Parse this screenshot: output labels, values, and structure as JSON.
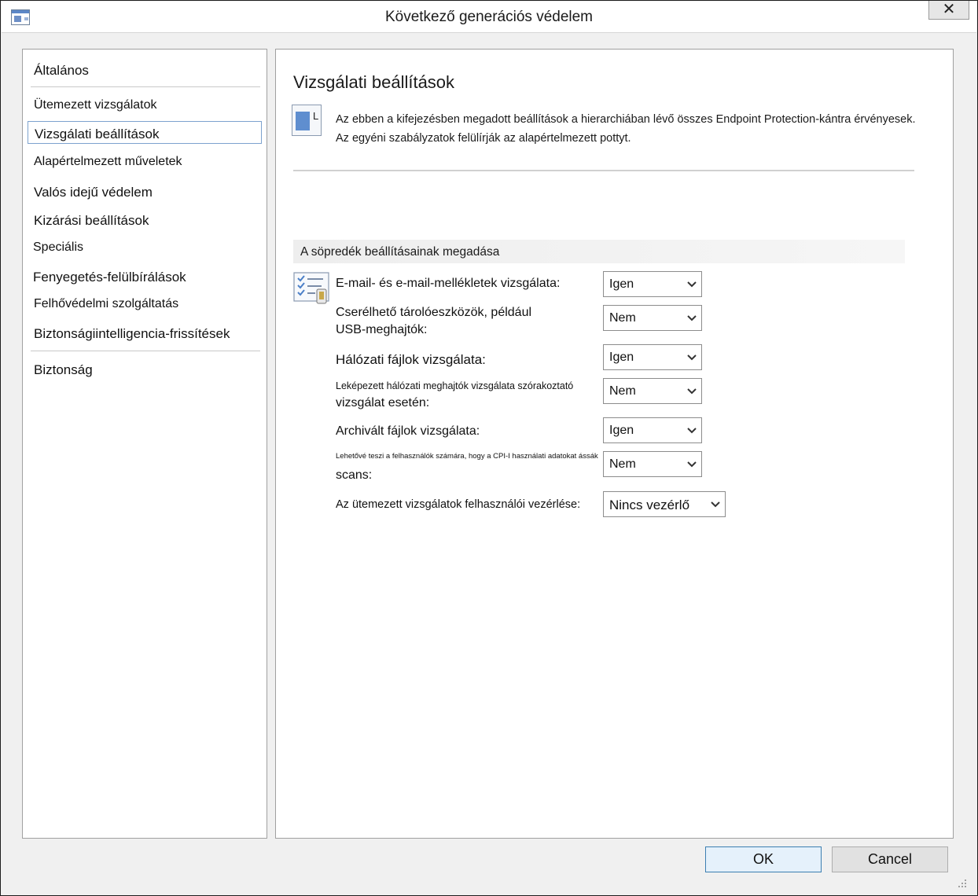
{
  "window": {
    "title": "Következő generációs védelem"
  },
  "close_glyph": "✕",
  "nav": {
    "items": [
      {
        "label": "Általános"
      },
      {
        "label": "Ütemezett vizsgálatok"
      },
      {
        "label": "Vizsgálati beállítások"
      },
      {
        "label": "Alapértelmezett műveletek"
      },
      {
        "label": "Valós idejű védelem"
      },
      {
        "label": "Kizárási beállítások"
      },
      {
        "label": "Speciális"
      },
      {
        "label": "Fenyegetés-felülbírálások"
      },
      {
        "label": "Felhővédelmi szolgáltatás"
      },
      {
        "label": "Biztonságiintelligencia-frissítések"
      },
      {
        "label": "Biztonság"
      }
    ],
    "selected_index": 2
  },
  "content": {
    "title": "Vizsgálati beállítások",
    "info_icon_letter": "L",
    "description_line1": "Az ebben a kifejezésben megadott beállítások a hierarchiában lévő összes Endpoint Protection-kántra érvényesek.",
    "description_line2": "Az egyéni szabályzatok felülírják az alapértelmezett pottyt.",
    "section_header": "A söpredék beállításainak megadása",
    "settings": [
      {
        "label_lines": [
          "E-mail- és e-mail-mellékletek vizsgálata:"
        ],
        "value": "Igen"
      },
      {
        "label_lines": [
          "Cserélhető tárolóeszközök, például",
          "USB-meghajtók:"
        ],
        "value": "Nem"
      },
      {
        "label_lines": [
          "Hálózati fájlok vizsgálata:"
        ],
        "value": "Igen"
      },
      {
        "label_lines": [
          "Leképezett hálózati meghajtók vizsgálata szórakoztató",
          "vizsgálat esetén:"
        ],
        "value": "Nem"
      },
      {
        "label_lines": [
          "Archivált fájlok vizsgálata:"
        ],
        "value": "Igen"
      },
      {
        "label_lines": [
          "Lehetővé teszi a felhasználók számára, hogy a CPI-I használati adatokat ássák",
          "scans:"
        ],
        "value": "Nem"
      },
      {
        "label_lines": [
          "Az ütemezett vizsgálatok felhasználói vezérlése:"
        ],
        "value": "Nincs vezérlő"
      }
    ]
  },
  "buttons": {
    "ok": "OK",
    "cancel": "Cancel"
  },
  "colors": {
    "selection_border": "#7da2ce",
    "icon_blue": "#5f8ecf"
  }
}
